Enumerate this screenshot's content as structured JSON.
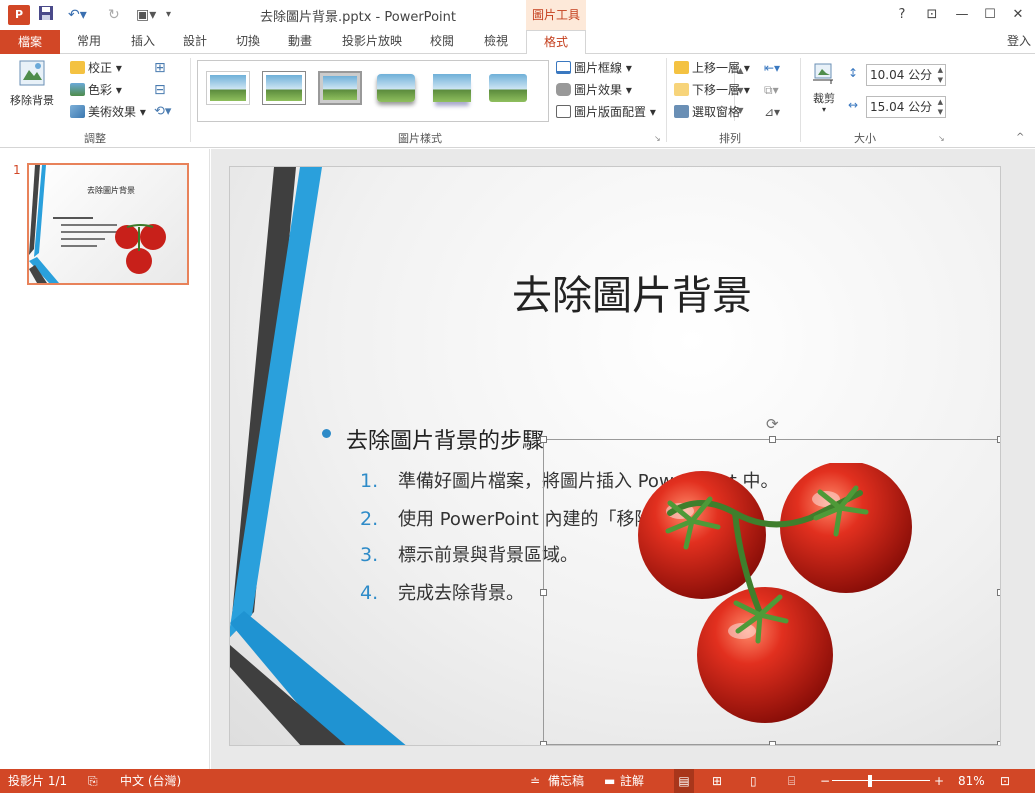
{
  "window": {
    "title": "去除圖片背景.pptx - PowerPoint",
    "context_tab": "圖片工具",
    "help": "?",
    "login": "登入"
  },
  "tabs": [
    "檔案",
    "常用",
    "插入",
    "設計",
    "切換",
    "動畫",
    "投影片放映",
    "校閱",
    "檢視",
    "格式"
  ],
  "ribbon": {
    "adjust": {
      "remove_bg": "移除背景",
      "corrections": "校正",
      "color": "色彩",
      "artistic": "美術效果",
      "label": "調整"
    },
    "styles": {
      "border": "圖片框線",
      "effects": "圖片效果",
      "layout": "圖片版面配置",
      "label": "圖片樣式"
    },
    "arrange": {
      "forward": "上移一層",
      "backward": "下移一層",
      "selection": "選取窗格",
      "label": "排列"
    },
    "size": {
      "crop": "裁剪",
      "height": "10.04 公分",
      "width": "15.04 公分",
      "label": "大小"
    }
  },
  "thumbnail": {
    "number": "1",
    "title": "去除圖片背景"
  },
  "slide": {
    "title": "去除圖片背景",
    "bullet": "去除圖片背景的步驟",
    "steps": [
      {
        "num": "1.",
        "text": "準備好圖片檔案，將圖片插入 PowerPoint 中。"
      },
      {
        "num": "2.",
        "text": "使用 PowerPoint 內建的「移除背景」功能。"
      },
      {
        "num": "3.",
        "text": "標示前景與背景區域。"
      },
      {
        "num": "4.",
        "text": "完成去除背景。"
      }
    ]
  },
  "status": {
    "slide_count": "投影片 1/1",
    "language": "中文 (台灣)",
    "notes": "備忘稿",
    "comments": "註解",
    "zoom": "81%",
    "minus": "−",
    "plus": "+"
  },
  "colors": {
    "accent": "#d24726",
    "bullet": "#2e8bc8"
  }
}
